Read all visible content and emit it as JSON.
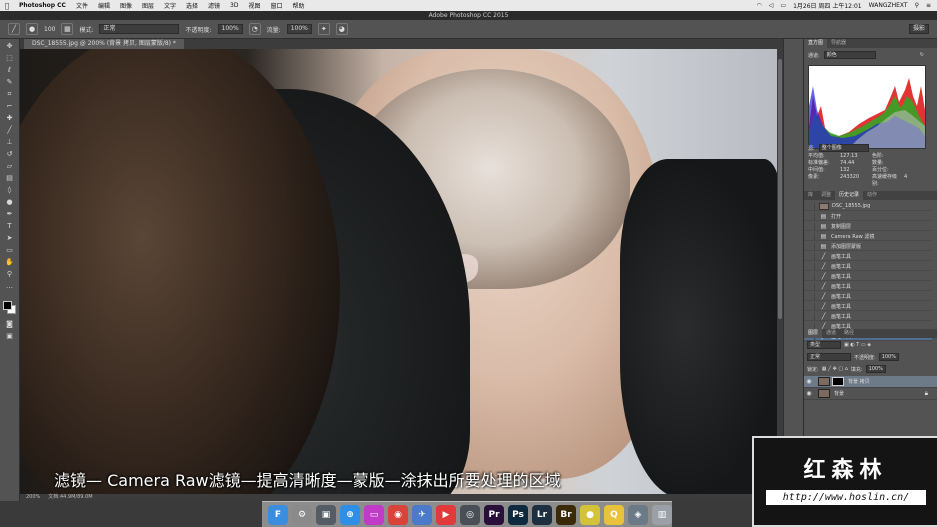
{
  "menubar": {
    "apple": "",
    "app_name": "Photoshop CC",
    "items": [
      "文件",
      "编辑",
      "图像",
      "图层",
      "文字",
      "选择",
      "滤镜",
      "3D",
      "视图",
      "窗口",
      "帮助"
    ],
    "datetime": "1月26日 周四 上午12:01",
    "user": "WANGZHEXT"
  },
  "titlebar": {
    "title": "Adobe Photoshop CC 2015"
  },
  "optionsbar": {
    "brush_size": "100",
    "mode_label": "模式:",
    "mode_value": "正常",
    "opacity_label": "不透明度:",
    "opacity_value": "100%",
    "flow_label": "流量:",
    "flow_value": "100%",
    "workspace": "摄影"
  },
  "document": {
    "tab_label": "DSC_18555.jpg @ 200% (背景 拷贝, 图层蒙版/8) *",
    "status_zoom": "200%",
    "status_doc": "文档:44.9M/89.0M"
  },
  "subtitle": "滤镜— Camera Raw滤镜—提高清晰度—蒙版—涂抹出所要处理的区域",
  "histogram_panel": {
    "tabs": [
      "直方图",
      "导航器"
    ],
    "channel_label": "通道:",
    "channel_value": "颜色",
    "source_label": "源:",
    "source_value": "整个图像",
    "stats": [
      {
        "label": "平均值:",
        "value": "127.13"
      },
      {
        "label": "色阶:",
        "value": ""
      },
      {
        "label": "标准偏差:",
        "value": "74.44"
      },
      {
        "label": "数量:",
        "value": ""
      },
      {
        "label": "中间值:",
        "value": "132"
      },
      {
        "label": "百分位:",
        "value": ""
      },
      {
        "label": "像素:",
        "value": "243320"
      },
      {
        "label": "高速缓存级别:",
        "value": "4"
      }
    ]
  },
  "history_panel": {
    "tabs": [
      "库",
      "调整",
      "历史记录",
      "动作"
    ],
    "snapshot": "DSC_18555.jpg",
    "items": [
      {
        "glyph": "▤",
        "label": "打开"
      },
      {
        "glyph": "▤",
        "label": "复制图层"
      },
      {
        "glyph": "▤",
        "label": "Camera Raw 滤镜"
      },
      {
        "glyph": "▤",
        "label": "添加图层蒙版"
      },
      {
        "glyph": "╱",
        "label": "画笔工具"
      },
      {
        "glyph": "╱",
        "label": "画笔工具"
      },
      {
        "glyph": "╱",
        "label": "画笔工具"
      },
      {
        "glyph": "╱",
        "label": "画笔工具"
      },
      {
        "glyph": "╱",
        "label": "画笔工具"
      },
      {
        "glyph": "╱",
        "label": "画笔工具"
      },
      {
        "glyph": "╱",
        "label": "画笔工具"
      },
      {
        "glyph": "╱",
        "label": "画笔工具"
      },
      {
        "glyph": "╱",
        "label": "画笔工具"
      }
    ],
    "selected_index": 12
  },
  "layers_panel": {
    "tabs": [
      "图层",
      "通道",
      "路径"
    ],
    "filter_value": "类型",
    "blend_value": "正常",
    "opacity_label": "不透明度:",
    "opacity_value": "100%",
    "lock_label": "锁定:",
    "fill_label": "填充:",
    "fill_value": "100%",
    "layers": [
      {
        "name": "背景 拷贝",
        "has_mask": true,
        "selected": true
      },
      {
        "name": "背景",
        "has_mask": false,
        "selected": false
      }
    ]
  },
  "watermark": {
    "title": "红森林",
    "url": "http://www.hoslin.cn/"
  },
  "dock": {
    "apps": [
      {
        "name": "finder-icon",
        "label": "F",
        "color": "#3b8de0"
      },
      {
        "name": "system-prefs-icon",
        "label": "⚙",
        "color": "#8a8a8a"
      },
      {
        "name": "photo-icon",
        "label": "▣",
        "color": "#555c66"
      },
      {
        "name": "safari-icon",
        "label": "⊕",
        "color": "#2f8fe6"
      },
      {
        "name": "screen-icon",
        "label": "▭",
        "color": "#c23ac8"
      },
      {
        "name": "chrome-icon",
        "label": "◉",
        "color": "#d9443a"
      },
      {
        "name": "mail-icon",
        "label": "✈",
        "color": "#4a7ac9"
      },
      {
        "name": "video-icon",
        "label": "▶",
        "color": "#e23a3a"
      },
      {
        "name": "quicktime-icon",
        "label": "◎",
        "color": "#4a4f57"
      },
      {
        "name": "premiere-icon",
        "label": "Pr",
        "color": "#2a0f3a"
      },
      {
        "name": "photoshop-icon",
        "label": "Ps",
        "color": "#0f2a3f"
      },
      {
        "name": "lightroom-icon",
        "label": "Lr",
        "color": "#1e2f3f"
      },
      {
        "name": "bridge-icon",
        "label": "Br",
        "color": "#3a2a08"
      },
      {
        "name": "ball-icon",
        "label": "●",
        "color": "#d4c23a"
      },
      {
        "name": "qq-icon",
        "label": "Q",
        "color": "#e8c23a"
      },
      {
        "name": "app-icon",
        "label": "◈",
        "color": "#6c7a88"
      },
      {
        "name": "trash-icon",
        "label": "▥",
        "color": "#9aa0a6"
      }
    ]
  }
}
